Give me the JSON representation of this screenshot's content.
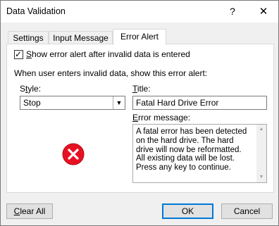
{
  "window": {
    "title": "Data Validation",
    "help_label": "?",
    "close_label": "✕"
  },
  "tabs": [
    {
      "label": "Settings",
      "active": false
    },
    {
      "label": "Input Message",
      "active": false
    },
    {
      "label": "Error Alert",
      "active": true
    }
  ],
  "error_alert": {
    "show_alert": {
      "checked": true,
      "check_glyph": "✓",
      "label_first": "S",
      "label_rest": "how error alert after invalid data is entered"
    },
    "when_label": "When user enters invalid data, show this error alert:",
    "style": {
      "label_first": "S",
      "label_middle": "t",
      "label_rest": "yle:",
      "value": "Stop",
      "icon": "stop-error-icon"
    },
    "title": {
      "label_first": "T",
      "label_rest": "itle:",
      "value": "Fatal Hard Drive Error"
    },
    "message": {
      "label_first": "E",
      "label_rest": "rror message:",
      "value": "A fatal error has been detected\non the hard drive.  The hard\ndrive will now be reformatted.\nAll existing data will be lost.\nPress any key to continue."
    }
  },
  "buttons": {
    "clear_all_first": "C",
    "clear_all_rest": "lear All",
    "ok": "OK",
    "cancel": "Cancel"
  },
  "colors": {
    "focus_blue": "#0078d7",
    "error_red": "#e81123"
  }
}
